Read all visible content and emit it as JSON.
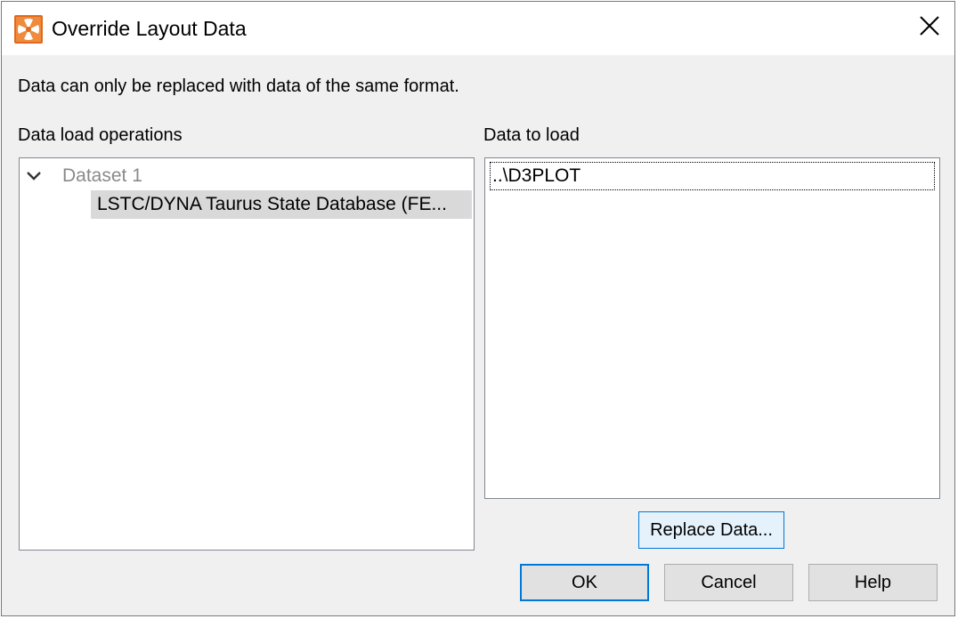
{
  "window": {
    "title": "Override Layout Data",
    "app_icon": "tecplot-app-icon",
    "close_icon": "close-icon"
  },
  "info": {
    "message": "Data can only be replaced with data of the same format."
  },
  "left_panel": {
    "label": "Data load operations",
    "tree": {
      "parent_label": "Dataset 1",
      "parent_expanded": true,
      "child_label": "LSTC/DYNA Taurus State Database (FE..."
    }
  },
  "right_panel": {
    "label": "Data to load",
    "items": [
      "..\\D3PLOT"
    ]
  },
  "buttons": {
    "replace_data": "Replace Data...",
    "ok": "OK",
    "cancel": "Cancel",
    "help": "Help"
  },
  "colors": {
    "accent": "#0078d7",
    "icon_orange": "#e06a1e",
    "selection_gray": "#d9d9d9"
  }
}
